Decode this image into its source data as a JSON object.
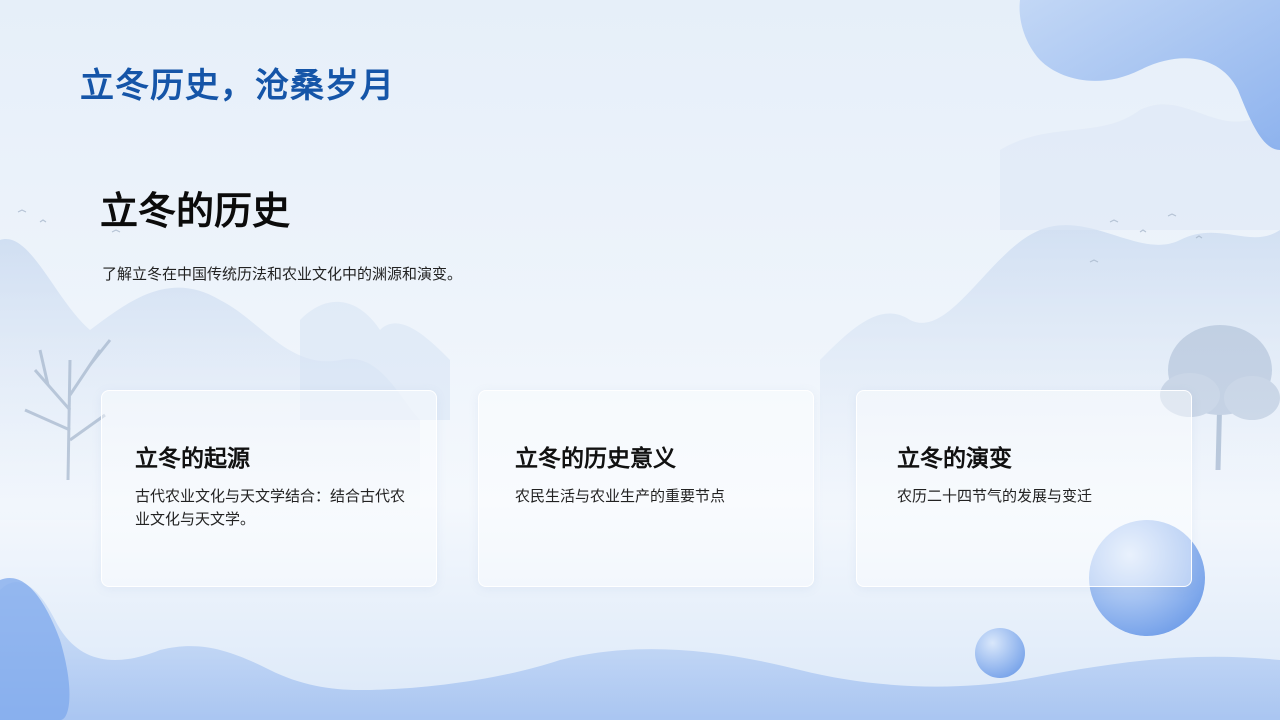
{
  "slide": {
    "title": "立冬历史，沧桑岁月",
    "section": {
      "heading": "立冬的历史",
      "description": "了解立冬在中国传统历法和农业文化中的渊源和演变。"
    },
    "cards": [
      {
        "title": "立冬的起源",
        "text": "古代农业文化与天文学结合：结合古代农业文化与天文学。"
      },
      {
        "title": "立冬的历史意义",
        "text": "农民生活与农业生产的重要节点"
      },
      {
        "title": "立冬的演变",
        "text": "农历二十四节气的发展与变迁"
      }
    ]
  },
  "colors": {
    "title": "#1555a8",
    "accent_blue": "#3f7fe0",
    "background": "#eaf2fb"
  }
}
